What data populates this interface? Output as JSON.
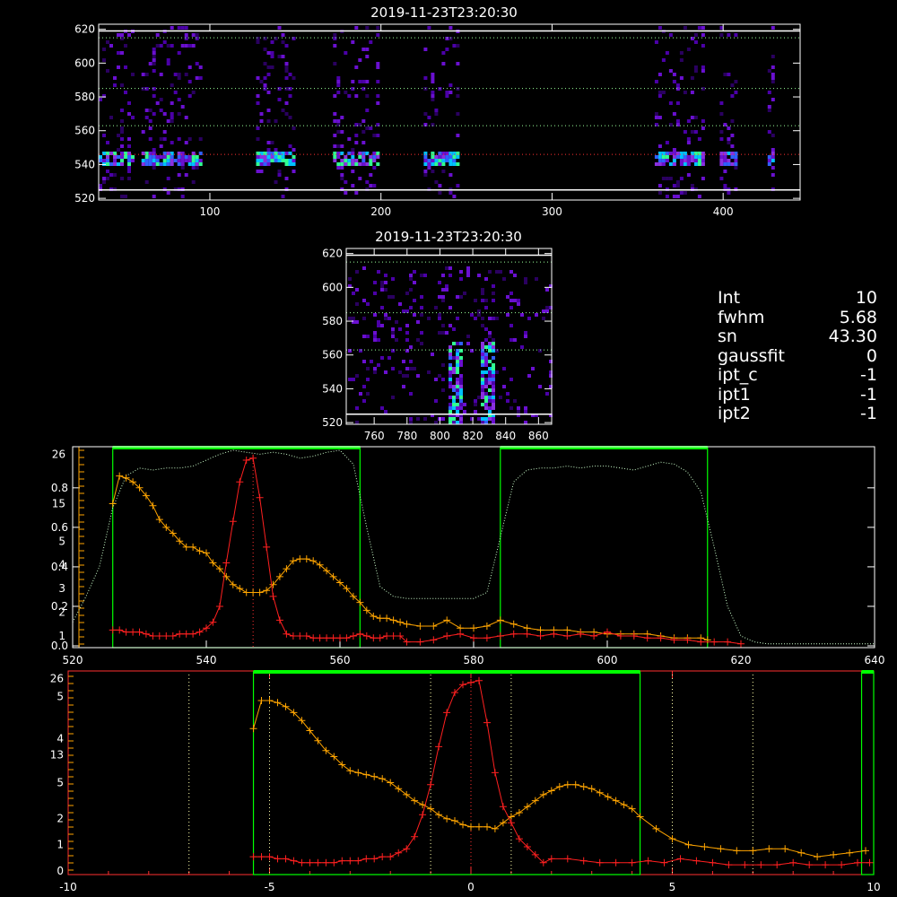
{
  "colors": {
    "frame": "#ffffff",
    "orange_series": "#ffa500",
    "red_series": "#ff2020",
    "green_band": "#00ff00",
    "green_dotted": "#ccffcc",
    "red_axis": "#ff3030",
    "heatmap_low": "#4b00a8",
    "heatmap_high": "#00ffff"
  },
  "readout": [
    {
      "key": "Int",
      "value": "10"
    },
    {
      "key": "fwhm",
      "value": "5.68"
    },
    {
      "key": "sn",
      "value": "43.30"
    },
    {
      "key": "gaussfit",
      "value": "0"
    },
    {
      "key": "ipt_c",
      "value": "-1"
    },
    {
      "key": "ipt1",
      "value": "-1"
    },
    {
      "key": "ipt2",
      "value": "-1"
    }
  ],
  "chart_data": [
    {
      "type": "heatmap",
      "title": "2019-11-23T23:20:30",
      "xlim": [
        35,
        445
      ],
      "ylim": [
        519,
        623
      ],
      "x_ticks": [
        100,
        200,
        300,
        400
      ],
      "y_ticks": [
        520,
        540,
        560,
        580,
        600,
        620
      ],
      "hlines_solid": [
        619,
        525
      ],
      "hlines_dotted": [
        615,
        585,
        563,
        546
      ],
      "emission_band_y": 544,
      "column_groups": [
        [
          35,
          55
        ],
        [
          60,
          95
        ],
        [
          127,
          148
        ],
        [
          172,
          198
        ],
        [
          225,
          245
        ],
        [
          360,
          388
        ],
        [
          398,
          408
        ],
        [
          426,
          430
        ]
      ]
    },
    {
      "type": "heatmap",
      "title": "2019-11-23T23:20:30",
      "xlim": [
        743,
        868
      ],
      "ylim": [
        519,
        623
      ],
      "x_ticks": [
        760,
        780,
        800,
        820,
        840,
        860
      ],
      "y_ticks": [
        520,
        540,
        560,
        580,
        600,
        620
      ],
      "hlines_solid": [
        619,
        525
      ],
      "hlines_dotted": [
        615,
        585,
        563
      ],
      "bright_columns": [
        809,
        829
      ]
    },
    {
      "type": "line",
      "xlim": [
        520,
        640
      ],
      "x_ticks": [
        520,
        540,
        560,
        580,
        600,
        620,
        640
      ],
      "left_axis_ticks": [
        "0.0",
        "0.2",
        "0.4",
        "0.6",
        "0.8"
      ],
      "left_axis_values": [
        0,
        0.2,
        0.4,
        0.6,
        0.8
      ],
      "left_axis_ylim": [
        0,
        0.99
      ],
      "red_axis_ticks": [
        "1",
        "2",
        "3",
        "4",
        "5",
        "15",
        "26"
      ],
      "green_rects": [
        [
          526,
          563
        ],
        [
          584,
          615
        ]
      ],
      "red_peak_x": 547,
      "series": [
        {
          "color": "orange",
          "x": [
            526,
            527,
            528,
            529,
            530,
            531,
            532,
            533,
            534,
            535,
            536,
            537,
            538,
            539,
            540,
            541,
            542,
            543,
            544,
            545,
            546,
            547,
            548,
            549,
            550,
            551,
            552,
            553,
            554,
            555,
            556,
            557,
            558,
            559,
            560,
            561,
            562,
            563,
            564,
            565,
            566,
            567,
            568,
            569,
            570,
            572,
            574,
            576,
            578,
            580,
            582,
            584,
            586,
            588,
            590,
            592,
            594,
            596,
            598,
            600,
            602,
            604,
            606,
            608,
            610,
            612,
            614,
            615
          ],
          "y": [
            0.72,
            0.86,
            0.85,
            0.83,
            0.8,
            0.76,
            0.71,
            0.64,
            0.6,
            0.57,
            0.53,
            0.5,
            0.5,
            0.48,
            0.47,
            0.42,
            0.39,
            0.35,
            0.31,
            0.29,
            0.27,
            0.27,
            0.27,
            0.28,
            0.31,
            0.35,
            0.39,
            0.43,
            0.44,
            0.44,
            0.43,
            0.41,
            0.38,
            0.35,
            0.32,
            0.29,
            0.25,
            0.22,
            0.18,
            0.15,
            0.14,
            0.14,
            0.13,
            0.12,
            0.11,
            0.1,
            0.1,
            0.13,
            0.09,
            0.09,
            0.1,
            0.13,
            0.11,
            0.09,
            0.08,
            0.08,
            0.08,
            0.07,
            0.07,
            0.06,
            0.06,
            0.06,
            0.06,
            0.05,
            0.04,
            0.04,
            0.04,
            0.03
          ]
        },
        {
          "color": "red",
          "x": [
            526,
            527,
            528,
            529,
            530,
            531,
            532,
            533,
            534,
            535,
            536,
            537,
            538,
            539,
            540,
            541,
            542,
            543,
            544,
            545,
            546,
            547,
            548,
            549,
            550,
            551,
            552,
            553,
            554,
            555,
            556,
            557,
            558,
            559,
            560,
            561,
            562,
            563,
            564,
            565,
            566,
            567,
            568,
            569,
            570,
            572,
            574,
            576,
            578,
            580,
            582,
            584,
            586,
            588,
            590,
            592,
            594,
            596,
            598,
            600,
            602,
            604,
            606,
            608,
            610,
            612,
            614,
            616,
            618,
            620
          ],
          "y": [
            0.08,
            0.08,
            0.07,
            0.07,
            0.07,
            0.06,
            0.05,
            0.05,
            0.05,
            0.05,
            0.06,
            0.06,
            0.06,
            0.07,
            0.09,
            0.12,
            0.2,
            0.42,
            0.63,
            0.83,
            0.94,
            0.95,
            0.75,
            0.5,
            0.25,
            0.13,
            0.06,
            0.05,
            0.05,
            0.05,
            0.04,
            0.04,
            0.04,
            0.04,
            0.04,
            0.04,
            0.05,
            0.06,
            0.05,
            0.04,
            0.04,
            0.05,
            0.05,
            0.05,
            0.02,
            0.02,
            0.03,
            0.05,
            0.06,
            0.04,
            0.04,
            0.05,
            0.06,
            0.06,
            0.05,
            0.06,
            0.05,
            0.06,
            0.05,
            0.07,
            0.05,
            0.05,
            0.04,
            0.04,
            0.03,
            0.03,
            0.02,
            0.02,
            0.02,
            0.01
          ]
        },
        {
          "color": "green-dotted",
          "x": [
            520,
            522,
            524,
            526,
            528,
            530,
            532,
            534,
            536,
            538,
            540,
            542,
            544,
            546,
            548,
            550,
            552,
            554,
            556,
            558,
            560,
            562,
            564,
            566,
            568,
            570,
            572,
            574,
            576,
            578,
            580,
            582,
            584,
            586,
            588,
            590,
            592,
            594,
            596,
            598,
            600,
            602,
            604,
            606,
            608,
            610,
            612,
            614,
            616,
            618,
            620,
            622,
            624,
            626,
            628,
            630,
            632,
            634,
            636,
            638,
            640
          ],
          "y": [
            0.12,
            0.25,
            0.4,
            0.7,
            0.86,
            0.9,
            0.89,
            0.9,
            0.9,
            0.91,
            0.94,
            0.97,
            0.99,
            0.98,
            0.97,
            0.98,
            0.97,
            0.95,
            0.96,
            0.98,
            0.99,
            0.92,
            0.6,
            0.3,
            0.25,
            0.24,
            0.24,
            0.24,
            0.24,
            0.24,
            0.24,
            0.27,
            0.55,
            0.83,
            0.89,
            0.9,
            0.9,
            0.91,
            0.9,
            0.91,
            0.91,
            0.9,
            0.89,
            0.91,
            0.93,
            0.92,
            0.88,
            0.78,
            0.5,
            0.2,
            0.05,
            0.02,
            0.01,
            0.01,
            0.01,
            0.01,
            0.01,
            0.01,
            0.01,
            0.01,
            0.01
          ]
        }
      ]
    },
    {
      "type": "line",
      "xlim": [
        -10,
        10
      ],
      "x_ticks": [
        -10,
        -5,
        0,
        5,
        10
      ],
      "red_axis_ticks": [
        "0",
        "1",
        "2",
        "5",
        "13",
        "4",
        "5",
        "26"
      ],
      "green_rects": [
        [
          -5.4,
          4.2
        ],
        [
          9.7,
          10.2
        ]
      ],
      "red_peak_x": 0,
      "dotted_vlines": [
        -7,
        -5,
        -1,
        1,
        5,
        7
      ],
      "series": [
        {
          "color": "orange",
          "x": [
            -5.4,
            -5.2,
            -5.0,
            -4.8,
            -4.6,
            -4.4,
            -4.2,
            -4.0,
            -3.8,
            -3.6,
            -3.4,
            -3.2,
            -3.0,
            -2.8,
            -2.6,
            -2.4,
            -2.2,
            -2.0,
            -1.8,
            -1.6,
            -1.4,
            -1.2,
            -1.0,
            -0.8,
            -0.6,
            -0.4,
            -0.2,
            0.0,
            0.2,
            0.4,
            0.6,
            0.8,
            1.0,
            1.2,
            1.4,
            1.6,
            1.8,
            2.0,
            2.2,
            2.4,
            2.6,
            2.8,
            3.0,
            3.2,
            3.4,
            3.6,
            3.8,
            4.0,
            4.2,
            4.6,
            5.0,
            5.4,
            5.8,
            6.2,
            6.6,
            7.0,
            7.4,
            7.8,
            8.2,
            8.6,
            9.0,
            9.4,
            9.8
          ],
          "y": [
            0.72,
            0.86,
            0.86,
            0.85,
            0.83,
            0.8,
            0.76,
            0.71,
            0.66,
            0.61,
            0.58,
            0.54,
            0.51,
            0.5,
            0.49,
            0.48,
            0.47,
            0.45,
            0.42,
            0.39,
            0.36,
            0.34,
            0.32,
            0.29,
            0.27,
            0.26,
            0.24,
            0.23,
            0.23,
            0.23,
            0.22,
            0.25,
            0.28,
            0.3,
            0.33,
            0.36,
            0.39,
            0.41,
            0.43,
            0.44,
            0.44,
            0.43,
            0.42,
            0.4,
            0.38,
            0.36,
            0.34,
            0.32,
            0.28,
            0.22,
            0.17,
            0.14,
            0.13,
            0.12,
            0.11,
            0.11,
            0.12,
            0.12,
            0.1,
            0.08,
            0.09,
            0.1,
            0.11
          ]
        },
        {
          "color": "red",
          "x": [
            -5.4,
            -5.2,
            -5.0,
            -4.8,
            -4.6,
            -4.4,
            -4.2,
            -4.0,
            -3.8,
            -3.6,
            -3.4,
            -3.2,
            -3.0,
            -2.8,
            -2.6,
            -2.4,
            -2.2,
            -2.0,
            -1.8,
            -1.6,
            -1.4,
            -1.2,
            -1.0,
            -0.8,
            -0.6,
            -0.4,
            -0.2,
            0.0,
            0.2,
            0.4,
            0.6,
            0.8,
            1.0,
            1.2,
            1.4,
            1.6,
            1.8,
            2.0,
            2.4,
            2.8,
            3.2,
            3.6,
            4.0,
            4.4,
            4.8,
            5.2,
            5.6,
            6.0,
            6.4,
            6.8,
            7.2,
            7.6,
            8.0,
            8.4,
            8.8,
            9.2,
            9.6,
            9.9
          ],
          "y": [
            0.08,
            0.08,
            0.08,
            0.07,
            0.07,
            0.06,
            0.05,
            0.05,
            0.05,
            0.05,
            0.05,
            0.06,
            0.06,
            0.06,
            0.07,
            0.07,
            0.08,
            0.08,
            0.1,
            0.12,
            0.18,
            0.29,
            0.44,
            0.63,
            0.8,
            0.9,
            0.94,
            0.95,
            0.96,
            0.75,
            0.5,
            0.33,
            0.25,
            0.17,
            0.13,
            0.09,
            0.05,
            0.07,
            0.07,
            0.06,
            0.05,
            0.05,
            0.05,
            0.06,
            0.05,
            0.07,
            0.06,
            0.05,
            0.04,
            0.04,
            0.04,
            0.04,
            0.05,
            0.04,
            0.04,
            0.04,
            0.05,
            0.05
          ]
        }
      ]
    }
  ]
}
